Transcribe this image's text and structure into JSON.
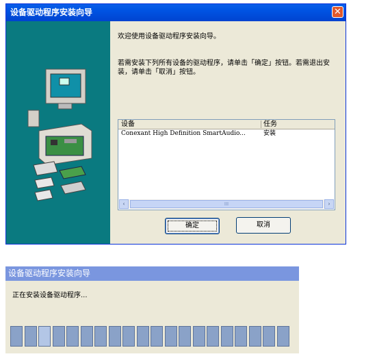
{
  "wizard": {
    "title": "设备驱动程序安装向导",
    "close_symbol": "✕",
    "welcome_text": "欢迎使用设备驱动程序安装向导。",
    "instructions": "若需安装下列所有设备的驱动程序，请单击「确定」按钮。若需退出安装，请单击「取消」按钮。",
    "list": {
      "columns": [
        "设备",
        "任务"
      ],
      "rows": [
        {
          "device": "Conexant High Definition SmartAudio...",
          "task": "安装"
        }
      ]
    },
    "scrollbar": {
      "left_arrow": "‹",
      "right_arrow": "›",
      "grip": "III"
    },
    "ok_label": "确定",
    "cancel_label": "取消"
  },
  "progress_window": {
    "title": "设备驱动程序安装向导",
    "status_text": "正在安装设备驱动程序...",
    "segment_count": 20,
    "highlighted_segment": 2
  },
  "colors": {
    "title_active": "#0054e3",
    "title_inactive": "#7a96df",
    "side_panel": "#0a7a80",
    "progress_segment": "#8aa2c8"
  }
}
